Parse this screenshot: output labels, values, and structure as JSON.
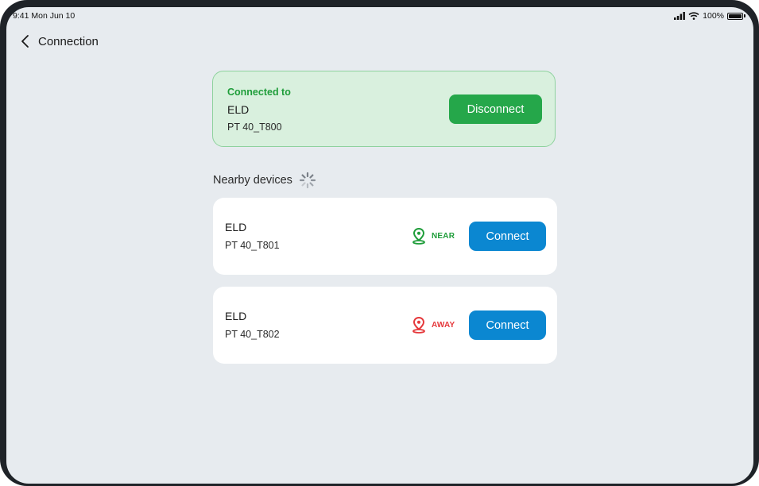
{
  "status_bar": {
    "time": "9:41",
    "date": "Mon Jun 10",
    "battery": "100%",
    "icons": [
      "signal-icon",
      "wifi-icon",
      "battery-icon"
    ]
  },
  "nav": {
    "title": "Connection",
    "back_icon": "chevron-left-icon"
  },
  "connected": {
    "label": "Connected to",
    "name": "ELD",
    "id": "PT 40_T800",
    "disconnect_label": "Disconnect"
  },
  "nearby": {
    "title": "Nearby devices",
    "loading_icon": "spinner-icon",
    "devices": [
      {
        "name": "ELD",
        "id": "PT 40_T801",
        "proximity": "NEAR",
        "proximity_color": "#1f9d3a",
        "connect_label": "Connect"
      },
      {
        "name": "ELD",
        "id": "PT 40_T802",
        "proximity": "AWAY",
        "proximity_color": "#e5383b",
        "connect_label": "Connect"
      }
    ]
  },
  "colors": {
    "background": "#e7ebef",
    "connected_bg": "#d9f0de",
    "connected_border": "#8fd29e",
    "disconnect_button": "#25a74a",
    "connect_button": "#0b87d1",
    "near": "#1f9d3a",
    "away": "#e5383b"
  }
}
